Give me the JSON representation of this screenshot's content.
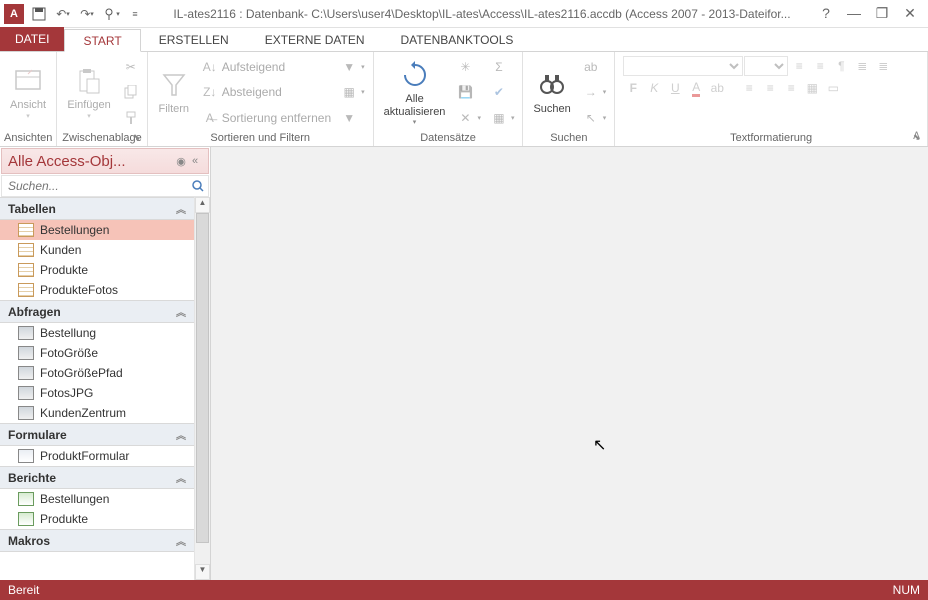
{
  "title": "IL-ates2116 : Datenbank- C:\\Users\\user4\\Desktop\\IL-ates\\Access\\IL-ates2116.accdb (Access 2007 - 2013-Dateifor...",
  "tabs": {
    "file": "DATEI",
    "start": "START",
    "erstellen": "ERSTELLEN",
    "externe": "EXTERNE DATEN",
    "tools": "DATENBANKTOOLS"
  },
  "ribbon": {
    "ansicht": "Ansicht",
    "ansichten": "Ansichten",
    "einfuegen": "Einfügen",
    "zwischenablage": "Zwischenablage",
    "filtern": "Filtern",
    "aufsteigend": "Aufsteigend",
    "absteigend": "Absteigend",
    "sortentfernen": "Sortierung entfernen",
    "sortfilter": "Sortieren und Filtern",
    "alleakt": "Alle\naktualisieren",
    "datensaetze": "Datensätze",
    "suchen": "Suchen",
    "suchenGroup": "Suchen",
    "textfmt": "Textformatierung"
  },
  "nav": {
    "header": "Alle Access-Obj...",
    "searchPlaceholder": "Suchen...",
    "sections": {
      "tabellen": "Tabellen",
      "abfragen": "Abfragen",
      "formulare": "Formulare",
      "berichte": "Berichte",
      "makros": "Makros"
    },
    "tables": [
      "Bestellungen",
      "Kunden",
      "Produkte",
      "ProdukteFotos"
    ],
    "queries": [
      "Bestellung",
      "FotoGröße",
      "FotoGrößePfad",
      "FotosJPG",
      "KundenZentrum"
    ],
    "forms": [
      "ProduktFormular"
    ],
    "reports": [
      "Bestellungen",
      "Produkte"
    ]
  },
  "status": {
    "left": "Bereit",
    "right": "NUM"
  }
}
